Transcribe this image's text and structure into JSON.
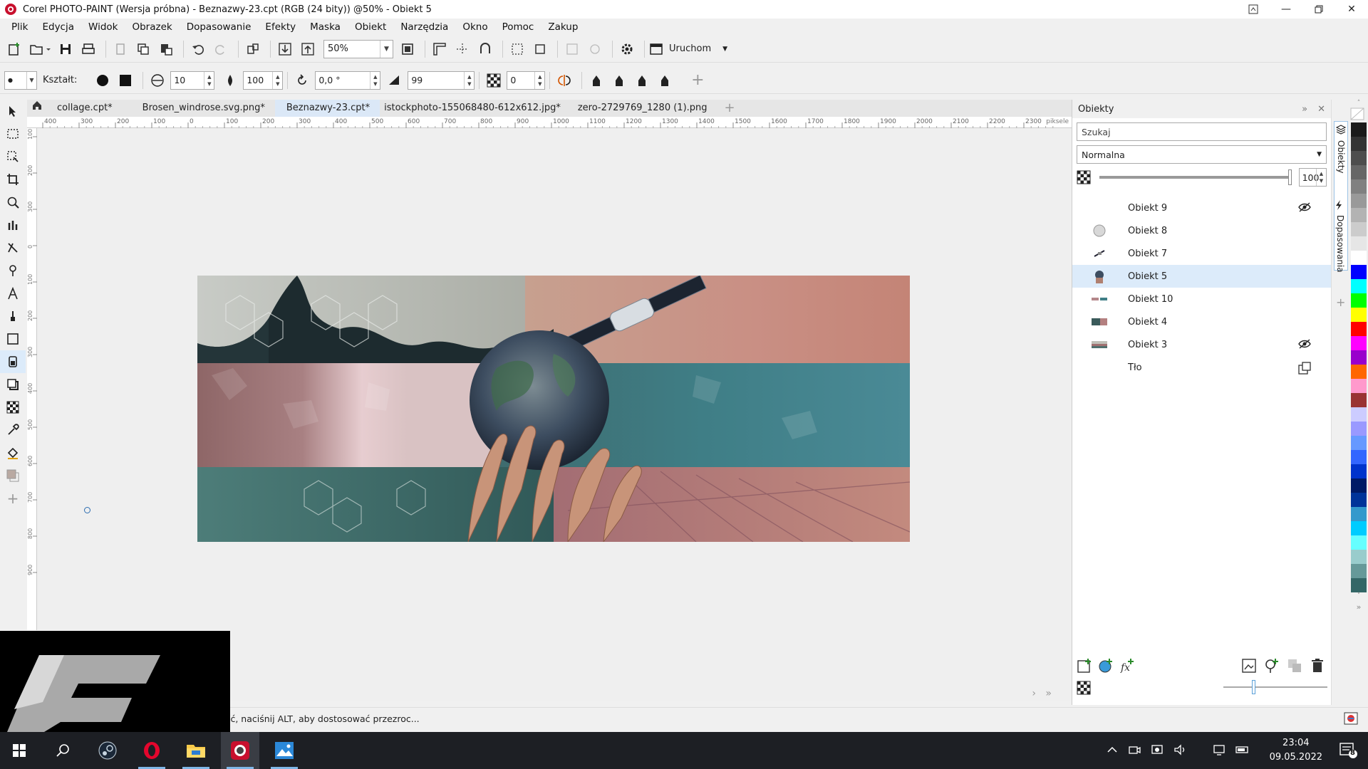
{
  "window": {
    "title": "Corel PHOTO-PAINT (Wersja próbna) - Beznazwy-23.cpt (RGB (24 bity)) @50% - Obiekt 5"
  },
  "menu": [
    "Plik",
    "Edycja",
    "Widok",
    "Obrazek",
    "Dopasowanie",
    "Efekty",
    "Maska",
    "Obiekt",
    "Narzędzia",
    "Okno",
    "Pomoc",
    "Zakup"
  ],
  "toolbar": {
    "zoom_value": "50%",
    "launch_label": "Uruchom"
  },
  "propbar": {
    "shape_label": "Kształt:",
    "nib_size": "10",
    "transparency": "100",
    "rotation": "0,0 °",
    "flatten": "99",
    "dither": "0"
  },
  "tabs": [
    {
      "label": "collage.cpt*",
      "active": false
    },
    {
      "label": "Brosen_windrose.svg.png*",
      "active": false
    },
    {
      "label": "Beznazwy-23.cpt*",
      "active": true
    },
    {
      "label": "istockphoto-155068480-612x612.jpg*",
      "active": false
    },
    {
      "label": "zero-2729769_1280 (1).png",
      "active": false
    }
  ],
  "ruler": {
    "unit": "piksele",
    "h_ticks": [
      "400",
      "300",
      "200",
      "100",
      "0",
      "100",
      "200",
      "300",
      "400",
      "500",
      "600",
      "700",
      "800",
      "900",
      "1000",
      "1100",
      "1200",
      "1300",
      "1400",
      "1500",
      "1600",
      "1700",
      "1800",
      "1900",
      "2000",
      "2100",
      "2200",
      "2300"
    ],
    "v_ticks": [
      "100",
      "200",
      "300",
      "0",
      "100",
      "200",
      "300",
      "400",
      "500",
      "600",
      "700",
      "800",
      "900"
    ]
  },
  "objects_panel": {
    "title": "Obiekty",
    "search_placeholder": "Szukaj",
    "blend_mode": "Normalna",
    "opacity": "100",
    "opacity_fraction": 1.0,
    "items": [
      {
        "name": "Obiekt 9",
        "hidden_icon": true,
        "selected": false
      },
      {
        "name": "Obiekt 8",
        "hidden_icon": false,
        "selected": false
      },
      {
        "name": "Obiekt 7",
        "hidden_icon": false,
        "selected": false
      },
      {
        "name": "Obiekt 5",
        "hidden_icon": false,
        "selected": true
      },
      {
        "name": "Obiekt 10",
        "hidden_icon": false,
        "selected": false
      },
      {
        "name": "Obiekt 4",
        "hidden_icon": false,
        "selected": false
      },
      {
        "name": "Obiekt 3",
        "hidden_icon": true,
        "selected": false
      },
      {
        "name": "Tło",
        "hidden_icon": false,
        "selected": false
      }
    ]
  },
  "docker_tabs": [
    "Obiekty",
    "Dopasowania"
  ],
  "status": {
    "text": "ić, naciśnij ALT, aby dostosować przezroc..."
  },
  "palette": [
    "#1a1a1a",
    "#333333",
    "#4d4d4d",
    "#666666",
    "#808080",
    "#999999",
    "#b3b3b3",
    "#cccccc",
    "#e6e6e6",
    "#ffffff",
    "#0000ff",
    "#00ffff",
    "#00ff00",
    "#ffff00",
    "#ff0000",
    "#ff00ff",
    "#9900cc",
    "#ff6600",
    "#ff99cc",
    "#993333",
    "#ccccff",
    "#9999ff",
    "#6699ff",
    "#3366ff",
    "#0033cc",
    "#001a66",
    "#003399",
    "#3399cc",
    "#00ccff",
    "#66ffff",
    "#99cccc",
    "#669999",
    "#336666"
  ],
  "taskbar": {
    "time": "23:04",
    "date": "09.05.2022",
    "notifications": "8"
  }
}
